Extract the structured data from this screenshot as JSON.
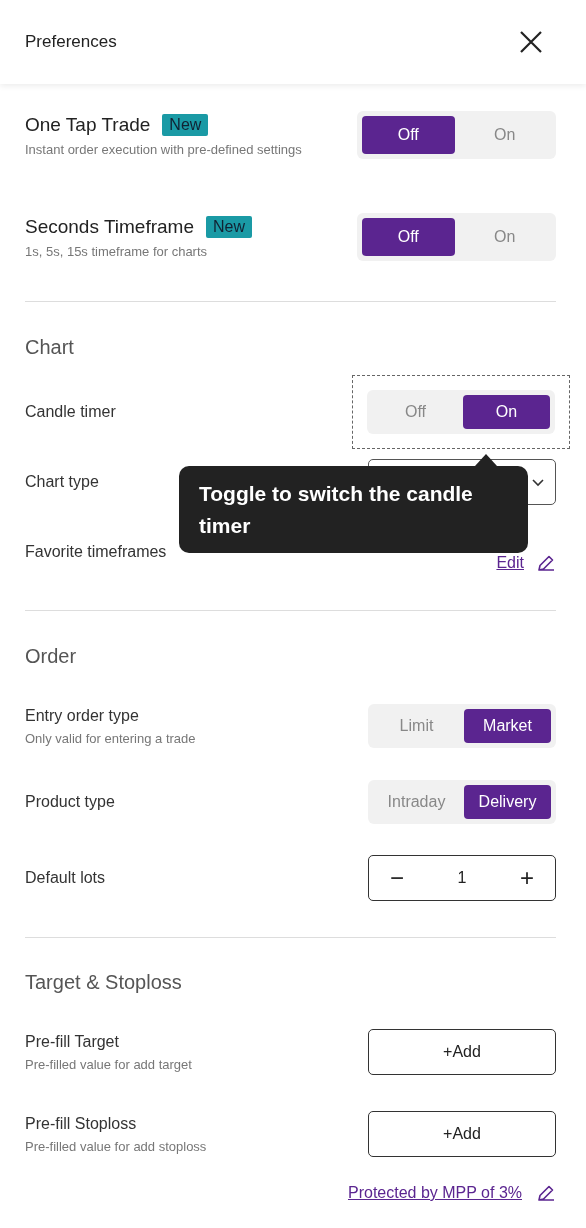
{
  "header": {
    "title": "Preferences"
  },
  "sections": [
    {
      "rows": [
        {
          "kind": "toggle",
          "label": "One Tap Trade",
          "badge": "New",
          "hint": "Instant order execution with pre-defined settings",
          "options": [
            {
              "label": "Off",
              "selected": true
            },
            {
              "label": "On",
              "selected": false
            }
          ]
        },
        {
          "kind": "toggle",
          "label": "Seconds Timeframe",
          "badge": "New",
          "hint": "1s, 5s, 15s timeframe for charts",
          "options": [
            {
              "label": "Off",
              "selected": true
            },
            {
              "label": "On",
              "selected": false
            }
          ]
        }
      ]
    },
    {
      "title": "Chart",
      "rows": [
        {
          "kind": "toggle",
          "label": "Candle timer",
          "highlighted": true,
          "options": [
            {
              "label": "Off",
              "selected": false
            },
            {
              "label": "On",
              "selected": true
            }
          ]
        },
        {
          "kind": "select",
          "label": "Chart type"
        },
        {
          "kind": "link",
          "label": "Favorite timeframes",
          "link": "Edit"
        }
      ]
    },
    {
      "title": "Order",
      "rows": [
        {
          "kind": "toggle",
          "label": "Entry order type",
          "hint": "Only valid for entering a trade",
          "options": [
            {
              "label": "Limit",
              "selected": false
            },
            {
              "label": "Market",
              "selected": true
            }
          ]
        },
        {
          "kind": "toggle",
          "label": "Product type",
          "options": [
            {
              "label": "Intraday",
              "selected": false
            },
            {
              "label": "Delivery",
              "selected": true
            }
          ]
        },
        {
          "kind": "stepper",
          "label": "Default lots",
          "decrement": "−",
          "value": "1",
          "increment": "+"
        }
      ]
    },
    {
      "title": "Target & Stoploss",
      "rows": [
        {
          "kind": "button",
          "label": "Pre-fill Target",
          "hint": "Pre-filled value for add target",
          "button": "+Add"
        },
        {
          "kind": "button",
          "label": "Pre-fill Stoploss",
          "hint": "Pre-filled value for add stoploss",
          "button": "+Add"
        }
      ]
    }
  ],
  "footer_link": "Protected by MPP of 3%",
  "tooltip": {
    "text": "Toggle to switch the candle timer"
  }
}
